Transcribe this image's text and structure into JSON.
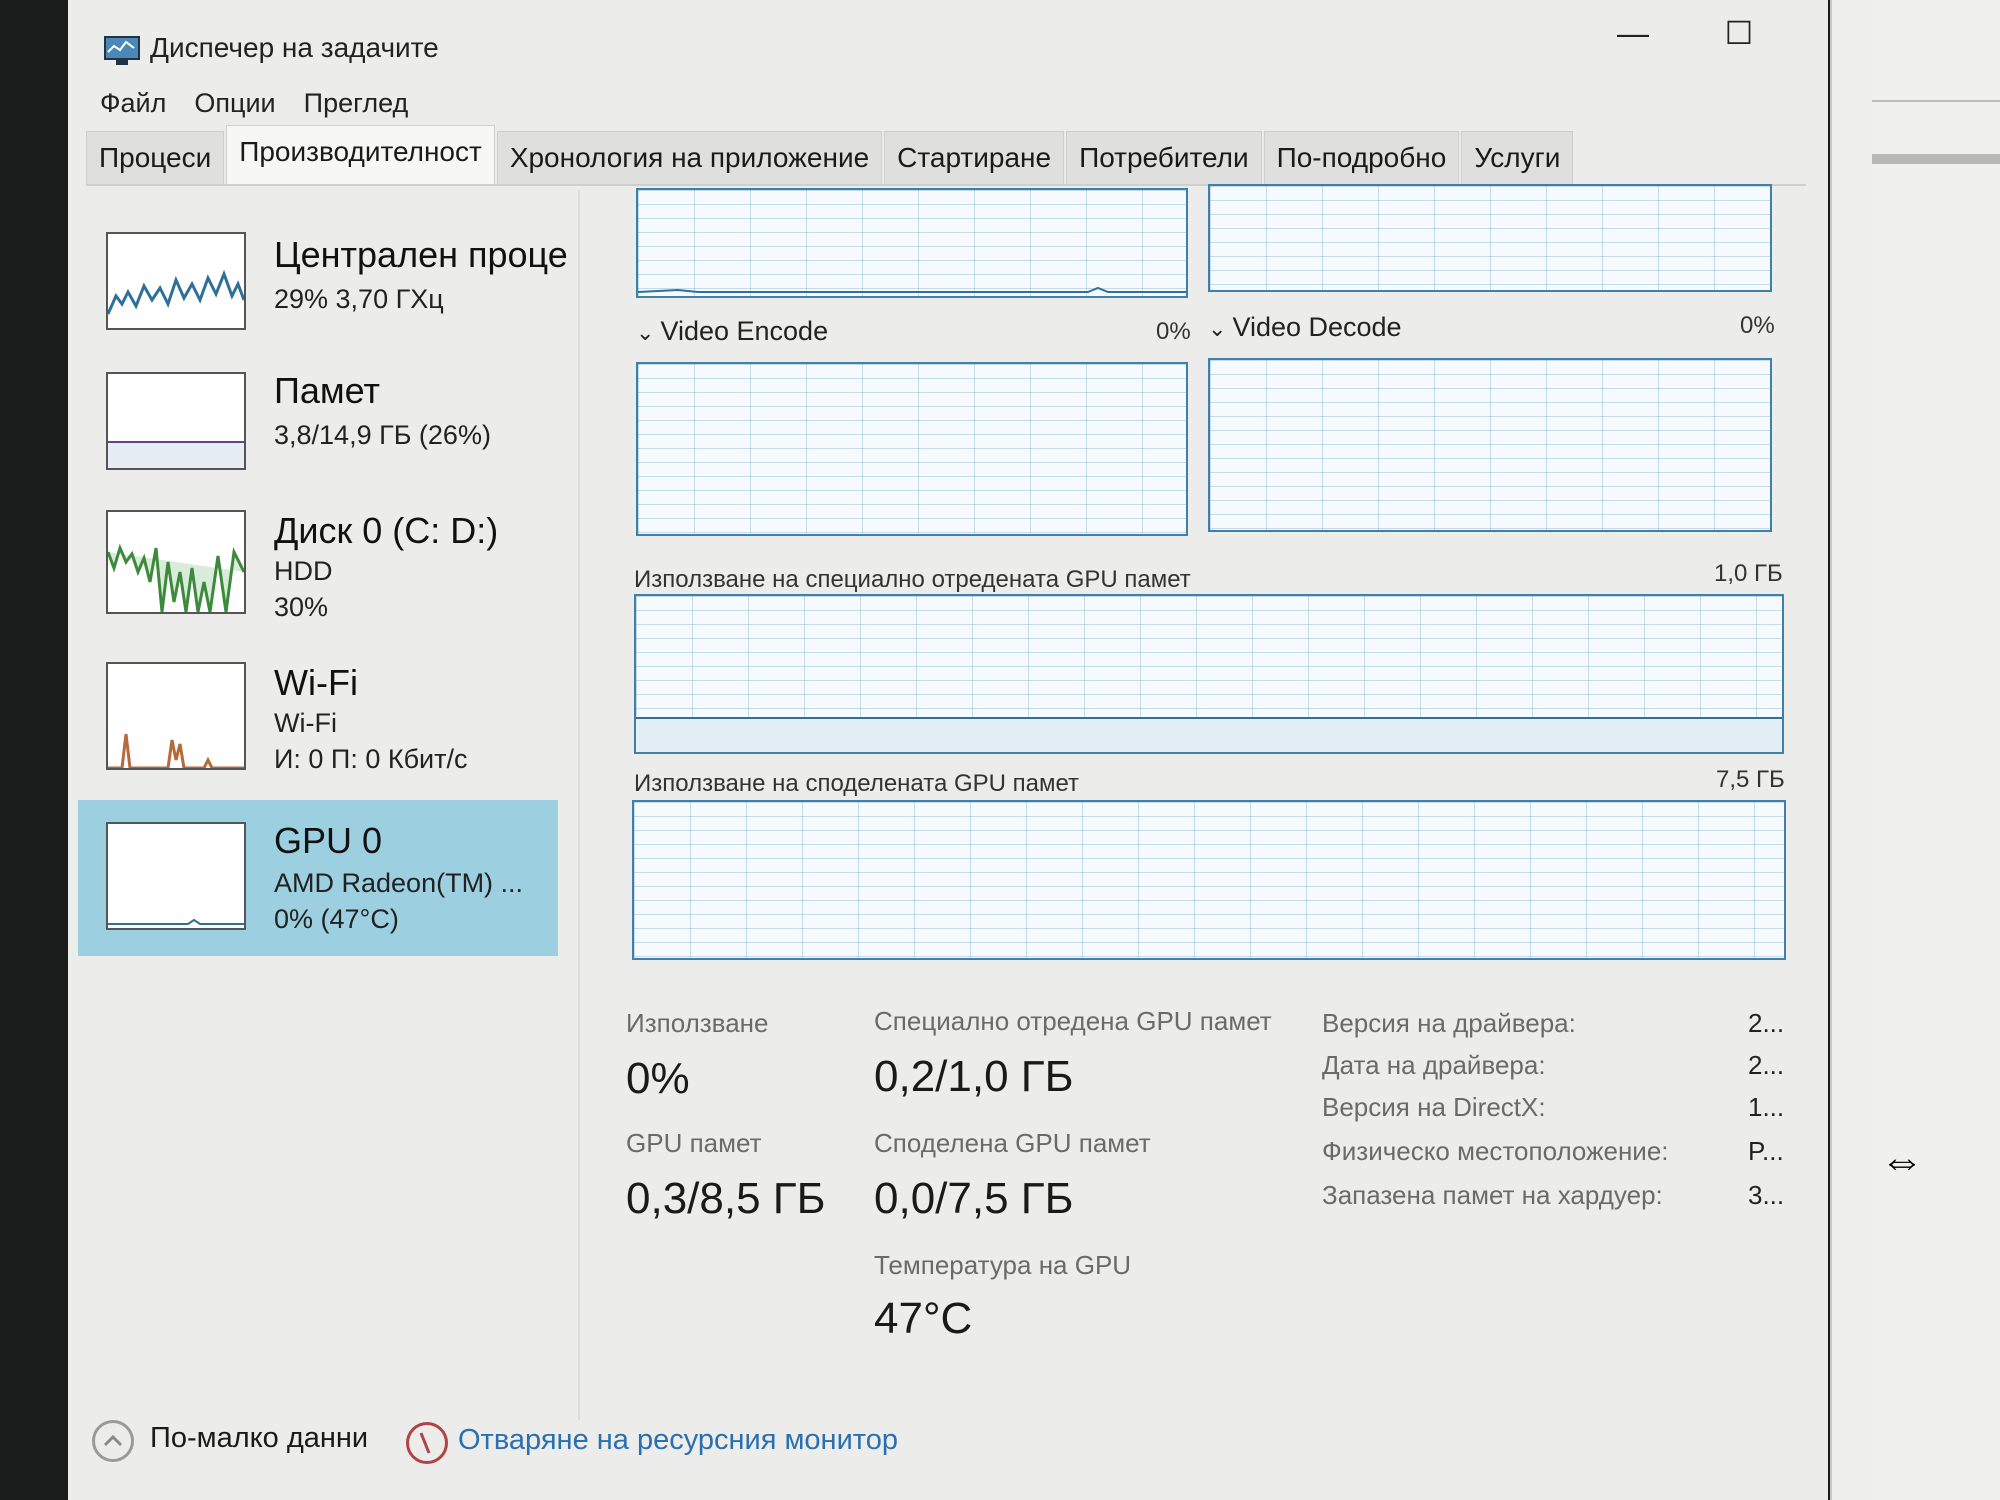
{
  "window": {
    "title": "Диспечер на задачите"
  },
  "window_controls": {
    "minimize": "—",
    "maximize": "☐",
    "close": "✕"
  },
  "menu": {
    "file": "Файл",
    "options": "Опции",
    "view": "Преглед"
  },
  "tabs": [
    {
      "label": "Процеси"
    },
    {
      "label": "Производителност"
    },
    {
      "label": "Хронология на приложение"
    },
    {
      "label": "Стартиране"
    },
    {
      "label": "Потребители"
    },
    {
      "label": "По-подробно"
    },
    {
      "label": "Услуги"
    }
  ],
  "sidebar": {
    "items": [
      {
        "title": "Централен проце",
        "sub1": "29% 3,70 ГХц",
        "sub2": "",
        "sub3": ""
      },
      {
        "title": "Памет",
        "sub1": "3,8/14,9 ГБ (26%)",
        "sub2": "",
        "sub3": ""
      },
      {
        "title": "Диск 0 (C: D:)",
        "sub1": "HDD",
        "sub2": "30%",
        "sub3": ""
      },
      {
        "title": "Wi-Fi",
        "sub1": "Wi-Fi",
        "sub2": "И: 0 П: 0 Кбит/с",
        "sub3": ""
      },
      {
        "title": "GPU 0",
        "sub1": "AMD Radeon(TM) ...",
        "sub2": "0% (47°C)",
        "sub3": ""
      }
    ]
  },
  "graphs": {
    "video_encode": {
      "label": "Video Encode",
      "value": "0%"
    },
    "video_decode": {
      "label": "Video Decode",
      "value": "0%"
    },
    "dedicated": {
      "label": "Използване на специално отредената GPU памет",
      "max": "1,0 ГБ"
    },
    "shared": {
      "label": "Използване на споделената GPU памет",
      "max": "7,5 ГБ"
    }
  },
  "stats": {
    "usage_label": "Използване",
    "usage_value": "0%",
    "dedicated_label": "Специално отредена GPU памет",
    "dedicated_value": "0,2/1,0 ГБ",
    "gpu_mem_label": "GPU памет",
    "gpu_mem_value": "0,3/8,5 ГБ",
    "shared_label": "Споделена GPU памет",
    "shared_value": "0,0/7,5 ГБ",
    "temp_label": "Температура на GPU",
    "temp_value": "47°C"
  },
  "properties": [
    {
      "label": "Версия на драйвера:",
      "value": "2..."
    },
    {
      "label": "Дата на драйвера:",
      "value": "2..."
    },
    {
      "label": "Версия на DirectX:",
      "value": "1..."
    },
    {
      "label": "Физическо местоположение:",
      "value": "P..."
    },
    {
      "label": "Запазена памет на хардуер:",
      "value": "3..."
    }
  ],
  "footer": {
    "fewer_details": "По-малко данни",
    "resource_monitor": "Отваряне на ресурсния монитор"
  },
  "colors": {
    "accent": "#3f7fa8",
    "selected": "#9ccfe0",
    "link": "#2a6fb0"
  }
}
